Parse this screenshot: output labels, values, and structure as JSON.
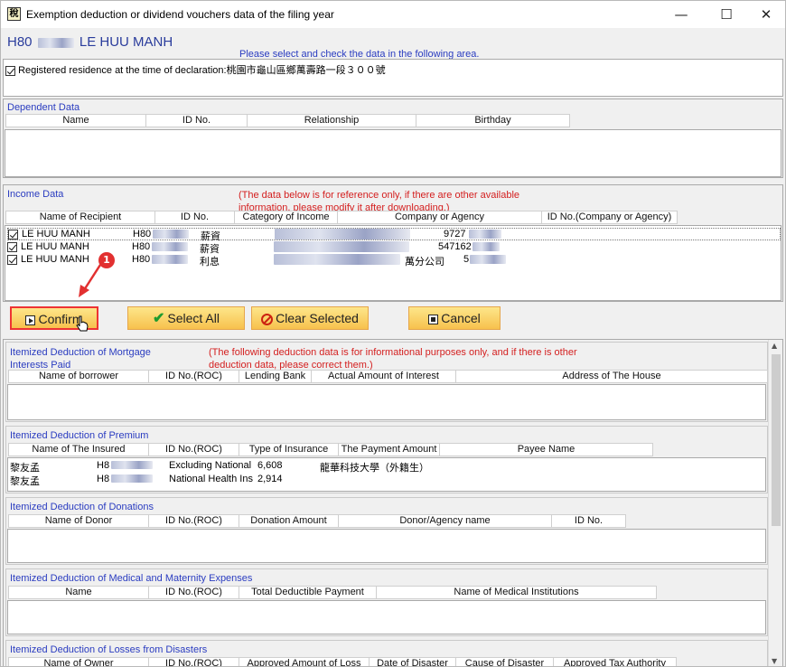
{
  "window": {
    "title": "Exemption deduction or dividend vouchers data of the filing year",
    "minimize": "—",
    "maximize": "☐",
    "close": "✕",
    "app_icon": "稅"
  },
  "person": {
    "id_prefix": "H80",
    "name": "LE HUU MANH"
  },
  "hint": "Please select and check the data in the following area.",
  "residence": {
    "label": "Registered residence at the time of declaration:",
    "value": "桃園市龜山區鄉萬壽路一段３００號"
  },
  "dependent": {
    "title": "Dependent Data",
    "columns": [
      "Name",
      "ID No.",
      "Relationship",
      "Birthday"
    ]
  },
  "income": {
    "title": "Income Data",
    "note": "(The data below is for reference only, if there are other available information, please modify it after downloading.)",
    "columns": [
      "Name of Recipient",
      "ID No.",
      "Category of Income",
      "Company or Agency",
      "ID No.(Company or Agency)"
    ],
    "rows": [
      {
        "name": "LE HUU MANH",
        "id": "H80",
        "category": "薪資",
        "company": "",
        "idc": "9727"
      },
      {
        "name": "LE HUU MANH",
        "id": "H80",
        "category": "薪資",
        "company": "",
        "idc": "547162"
      },
      {
        "name": "LE HUU MANH",
        "id": "H80",
        "category": "利息",
        "company": "萬分公司",
        "idc": "5"
      }
    ]
  },
  "buttons": {
    "confirm": "Confirm",
    "select_all": "Select All",
    "clear_selected": "Clear Selected",
    "cancel": "Cancel"
  },
  "annotation_badge": "1",
  "mortgage": {
    "title": "Itemized Deduction of Mortgage Interests Paid",
    "note": "(The following deduction data is for informational purposes only, and if there is other deduction data, please correct them.)",
    "columns": [
      "Name of borrower",
      "ID No.(ROC)",
      "Lending Bank",
      "Actual Amount of Interest",
      "Address of The House"
    ]
  },
  "premium": {
    "title": "Itemized Deduction of Premium",
    "columns": [
      "Name of The Insured",
      "ID No.(ROC)",
      "Type of Insurance",
      "The Payment Amount",
      "Payee Name"
    ],
    "rows": [
      {
        "name": "黎友孟",
        "id": "H8",
        "type": "Excluding National",
        "amount": "6,608",
        "payee": "龍華科技大學（外籍生）"
      },
      {
        "name": "黎友孟",
        "id": "H8",
        "type": "National Health Ins",
        "amount": "2,914",
        "payee": ""
      }
    ]
  },
  "donations": {
    "title": "Itemized Deduction of Donations",
    "columns": [
      "Name of Donor",
      "ID No.(ROC)",
      "Donation Amount",
      "Donor/Agency name",
      "ID No."
    ]
  },
  "medical": {
    "title": "Itemized Deduction of Medical and Maternity Expenses",
    "columns": [
      "Name",
      "ID No.(ROC)",
      "Total Deductible Payment",
      "Name of Medical Institutions"
    ]
  },
  "disasters": {
    "title": "Itemized Deduction of Losses from Disasters",
    "columns": [
      "Name of Owner",
      "ID No.(ROC)",
      "Approved Amount of Loss",
      "Date of Disaster",
      "Cause of Disaster",
      "Approved Tax Authority"
    ]
  },
  "colors": {
    "accent": "#2a3cc0",
    "warning": "#d42020",
    "button": "#f7c14d"
  }
}
